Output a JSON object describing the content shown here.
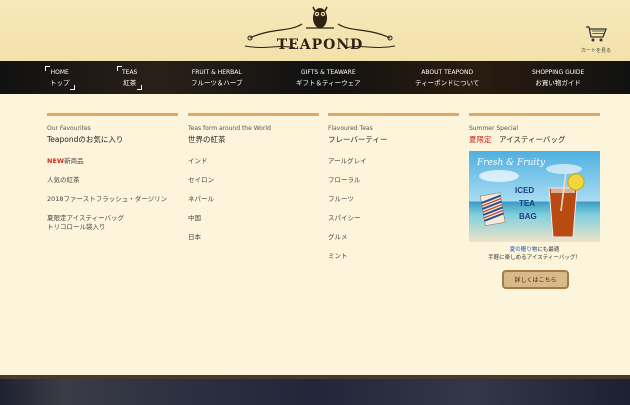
{
  "brand": {
    "name": "TEAPOND"
  },
  "cart": {
    "label": "カートを見る",
    "icon": "cart-icon"
  },
  "nav": {
    "items": [
      {
        "en": "HOME",
        "jp": "トップ"
      },
      {
        "en": "TEAS",
        "jp": "紅茶"
      },
      {
        "en": "FRUIT & HERBAL",
        "jp": "フルーツ＆ハーブ"
      },
      {
        "en": "GIFTS & TEAWARE",
        "jp": "ギフト＆ティーウェア"
      },
      {
        "en": "ABOUT TEAPOND",
        "jp": "ティーポンドについて"
      },
      {
        "en": "SHOPPING GUIDE",
        "jp": "お買い物ガイド"
      }
    ]
  },
  "columns": {
    "favourites": {
      "en": "Our Favourites",
      "jp": "Teapondのお気に入り",
      "new_tag": "NEW",
      "items": [
        "新商品",
        "人気の紅茶",
        "2018ファーストフラッシュ・ダージリン",
        "夏限定アイスティーバッグ",
        "トリコロール袋入り"
      ]
    },
    "world": {
      "en": "Teas form around the World",
      "jp": "世界の紅茶",
      "items": [
        "インド",
        "セイロン",
        "ネパール",
        "中国",
        "日本"
      ]
    },
    "flavoured": {
      "en": "Flavoured Teas",
      "jp": "フレーバーティー",
      "items": [
        "アールグレイ",
        "フローラル",
        "フルーツ",
        "スパイシー",
        "グルメ",
        "ミント"
      ]
    },
    "summer": {
      "en": "Summer Special",
      "jp_red": "夏限定",
      "jp": "アイスティーバッグ",
      "image_text": {
        "script": "Fresh & Fruity",
        "line1": "ICED",
        "line2": "TEA",
        "line3": "BAG"
      },
      "caption_blue": "夏の贈り物",
      "caption_mid": "にも最適",
      "caption_line2": "手軽に楽しめるアイスティーバッグ！",
      "button": "詳しくはこちら"
    }
  },
  "colors": {
    "accent_rule": "#e0a765",
    "new_red": "#d32a1f",
    "nav_bg": "#111111",
    "page_bg": "#fcf5dc"
  }
}
